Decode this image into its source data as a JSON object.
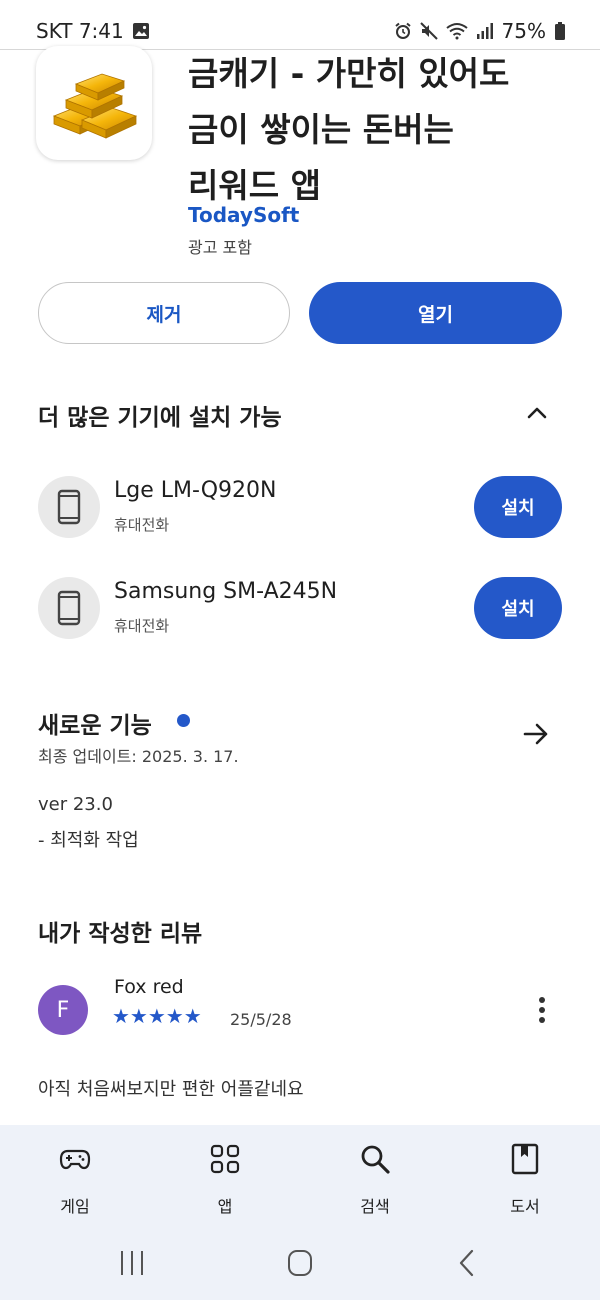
{
  "status_bar": {
    "carrier_time": "SKT 7:41",
    "battery": "75%"
  },
  "app": {
    "title_lines": [
      "금캐기 - 가만히 있어도",
      "금이 쌓이는 돈버는",
      "리워드 앱"
    ],
    "developer": "TodaySoft",
    "ads_label": "광고 포함"
  },
  "actions": {
    "remove_label": "제거",
    "open_label": "열기"
  },
  "more_devices": {
    "title": "더 많은 기기에 설치 가능",
    "devices": [
      {
        "name": "Lge LM-Q920N",
        "type": "휴대전화",
        "install_label": "설치"
      },
      {
        "name": "Samsung SM-A245N",
        "type": "휴대전화",
        "install_label": "설치"
      }
    ]
  },
  "whats_new": {
    "title": "새로운 기능",
    "updated": "최종 업데이트: 2025. 3. 17.",
    "notes": [
      "ver 23.0",
      "- 최적화 작업"
    ]
  },
  "my_review": {
    "title": "내가 작성한 리뷰",
    "avatar_letter": "F",
    "reviewer": "Fox red",
    "stars": "★★★★★",
    "rating": 5,
    "date": "25/5/28",
    "text": "아직 처음써보지만 편한 어플같네요"
  },
  "bottom_nav": [
    {
      "label": "게임",
      "icon": "gamepad-icon"
    },
    {
      "label": "앱",
      "icon": "apps-grid-icon"
    },
    {
      "label": "검색",
      "icon": "search-icon"
    },
    {
      "label": "도서",
      "icon": "book-icon"
    }
  ],
  "colors": {
    "accent": "#2458c9",
    "link": "#1a57c4",
    "avatar": "#7e57c2",
    "nav_bg": "#eef2f9"
  }
}
